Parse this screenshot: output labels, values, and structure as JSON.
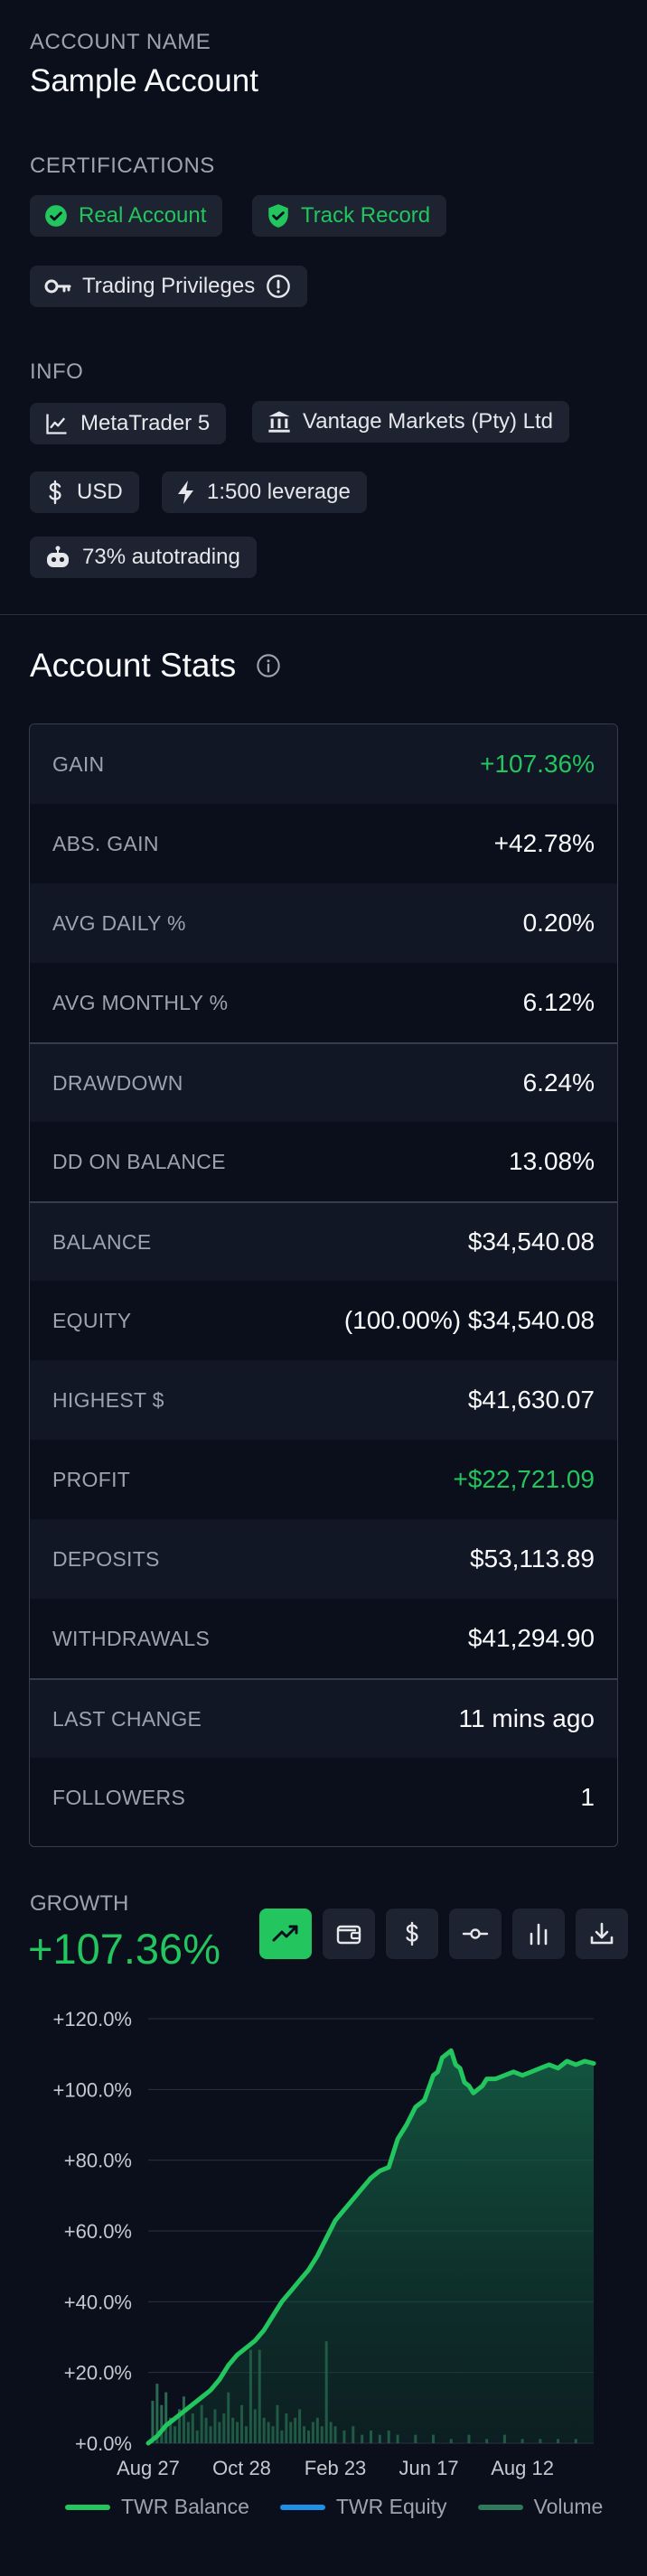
{
  "account": {
    "label": "ACCOUNT NAME",
    "name": "Sample Account"
  },
  "certifications": {
    "label": "CERTIFICATIONS",
    "real_account": "Real Account",
    "track_record": "Track Record",
    "trading_privileges": "Trading Privileges"
  },
  "info": {
    "label": "INFO",
    "platform": "MetaTrader 5",
    "broker": "Vantage Markets (Pty) Ltd",
    "currency": "USD",
    "leverage": "1:500 leverage",
    "autotrading": "73% autotrading"
  },
  "stats": {
    "title": "Account Stats",
    "rows": [
      {
        "key": "GAIN",
        "value": "+107.36%"
      },
      {
        "key": "ABS. GAIN",
        "value": "+42.78%"
      },
      {
        "key": "AVG DAILY %",
        "value": "0.20%"
      },
      {
        "key": "AVG MONTHLY %",
        "value": "6.12%"
      },
      {
        "key": "DRAWDOWN",
        "value": "6.24%"
      },
      {
        "key": "DD ON BALANCE",
        "value": "13.08%"
      },
      {
        "key": "BALANCE",
        "value": "$34,540.08"
      },
      {
        "key": "EQUITY",
        "value": "(100.00%) $34,540.08"
      },
      {
        "key": "HIGHEST $",
        "value": "$41,630.07"
      },
      {
        "key": "PROFIT",
        "value": "+$22,721.09"
      },
      {
        "key": "DEPOSITS",
        "value": "$53,113.89"
      },
      {
        "key": "WITHDRAWALS",
        "value": "$41,294.90"
      },
      {
        "key": "LAST CHANGE",
        "value": "11 mins ago"
      },
      {
        "key": "FOLLOWERS",
        "value": "1"
      }
    ]
  },
  "growth": {
    "label": "GROWTH",
    "value": "+107.36%"
  },
  "colors": {
    "accent_green": "#22c55e",
    "background": "#0b0f1c",
    "equity_blue": "#1e90e6",
    "volume_green": "#2f7a5a"
  },
  "toolbar": {
    "icons": [
      "trend-icon",
      "wallet-icon",
      "dollar-icon",
      "commit-icon",
      "bar-chart-icon",
      "download-icon"
    ]
  },
  "chart_data": {
    "type": "line",
    "ylim": [
      0,
      120
    ],
    "y_ticks": [
      "+0.0%",
      "+20.0%",
      "+40.0%",
      "+60.0%",
      "+80.0%",
      "+100.0%",
      "+120.0%"
    ],
    "x_ticks": [
      "Aug 27",
      "Oct 28",
      "Feb 23",
      "Jun 17",
      "Aug 12"
    ],
    "x_tick_positions": [
      0.0,
      0.21,
      0.42,
      0.63,
      0.84
    ],
    "grid": true,
    "legend_position": "bottom",
    "series": [
      {
        "name": "TWR Balance",
        "color": "#22c55e",
        "x": [
          0,
          0.02,
          0.04,
          0.06,
          0.08,
          0.1,
          0.12,
          0.14,
          0.16,
          0.18,
          0.2,
          0.22,
          0.24,
          0.26,
          0.28,
          0.3,
          0.32,
          0.34,
          0.36,
          0.38,
          0.4,
          0.42,
          0.44,
          0.46,
          0.48,
          0.5,
          0.52,
          0.54,
          0.56,
          0.58,
          0.6,
          0.62,
          0.64,
          0.65,
          0.66,
          0.67,
          0.68,
          0.69,
          0.7,
          0.71,
          0.72,
          0.73,
          0.74,
          0.75,
          0.76,
          0.78,
          0.8,
          0.82,
          0.84,
          0.86,
          0.88,
          0.9,
          0.92,
          0.94,
          0.96,
          0.98,
          1.0
        ],
        "values": [
          0,
          2,
          5,
          7,
          9,
          11,
          13,
          15,
          18,
          22,
          25,
          27,
          29,
          32,
          36,
          40,
          43,
          46,
          49,
          53,
          58,
          63,
          66,
          69,
          72,
          75,
          77,
          78,
          86,
          90,
          95,
          97,
          104,
          105,
          109,
          110,
          111,
          107,
          106,
          102,
          101,
          99,
          100,
          101,
          103,
          103,
          104,
          105,
          104,
          105,
          106,
          107,
          106,
          108,
          107,
          108,
          107.36
        ]
      },
      {
        "name": "TWR Equity",
        "color": "#1e90e6",
        "values": []
      },
      {
        "name": "Volume",
        "color": "#2f7a5a",
        "x": [
          0.01,
          0.02,
          0.03,
          0.04,
          0.05,
          0.06,
          0.07,
          0.08,
          0.09,
          0.1,
          0.11,
          0.12,
          0.13,
          0.14,
          0.15,
          0.16,
          0.17,
          0.18,
          0.19,
          0.2,
          0.21,
          0.22,
          0.23,
          0.24,
          0.25,
          0.26,
          0.27,
          0.28,
          0.29,
          0.3,
          0.31,
          0.32,
          0.33,
          0.34,
          0.35,
          0.36,
          0.37,
          0.38,
          0.39,
          0.4,
          0.41,
          0.42,
          0.44,
          0.46,
          0.48,
          0.5,
          0.52,
          0.54,
          0.56,
          0.6,
          0.64,
          0.68,
          0.72,
          0.76,
          0.8,
          0.84,
          0.88,
          0.92,
          0.96
        ],
        "values": [
          10,
          14,
          9,
          12,
          6,
          4,
          8,
          11,
          5,
          7,
          3,
          9,
          6,
          4,
          8,
          5,
          7,
          12,
          6,
          5,
          9,
          4,
          22,
          8,
          22,
          6,
          5,
          4,
          9,
          3,
          7,
          5,
          6,
          8,
          4,
          3,
          5,
          6,
          4,
          24,
          5,
          4,
          3,
          4,
          2,
          3,
          2,
          3,
          2,
          2,
          2,
          1,
          2,
          1,
          2,
          1,
          1,
          1,
          1
        ]
      }
    ],
    "volume_max": 100
  }
}
